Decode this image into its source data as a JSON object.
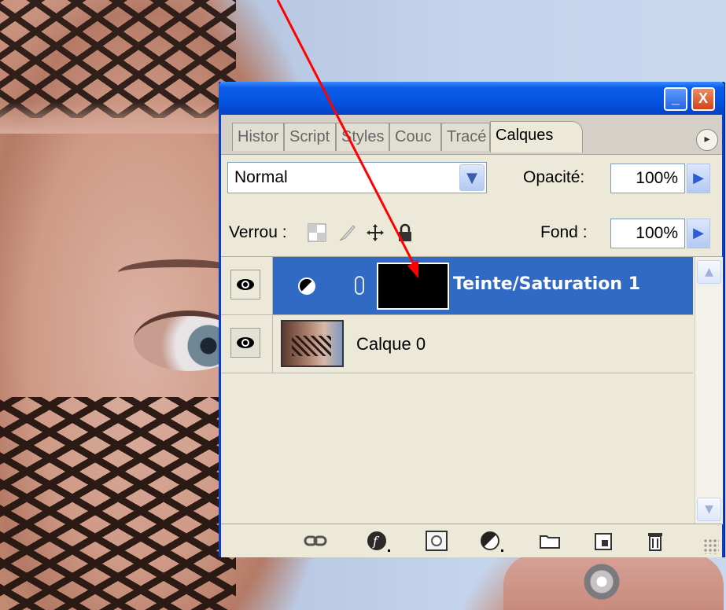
{
  "window": {
    "minimize_glyph": "_",
    "close_glyph": "X"
  },
  "tabs": [
    {
      "label": "Histor",
      "active": false
    },
    {
      "label": "Script",
      "active": false
    },
    {
      "label": "Styles",
      "active": false
    },
    {
      "label": "Couc",
      "active": false
    },
    {
      "label": "Tracé",
      "active": false
    },
    {
      "label": "Calques",
      "active": true
    }
  ],
  "blend": {
    "mode": "Normal",
    "opacity_label": "Opacité:",
    "opacity_value": "100%"
  },
  "lock": {
    "label": "Verrou :",
    "fill_label": "Fond :",
    "fill_value": "100%"
  },
  "layers": [
    {
      "name": "Teinte/Saturation 1",
      "visible": true,
      "selected": true,
      "type": "adjustment"
    },
    {
      "name": "Calque 0",
      "visible": true,
      "selected": false,
      "type": "image"
    }
  ],
  "toolbar_icons": [
    "link-icon",
    "layer-style-icon",
    "mask-icon",
    "adjustment-layer-icon",
    "group-folder-icon",
    "new-layer-icon",
    "trash-icon"
  ],
  "colors": {
    "selection": "#316ac5",
    "titlebar": "#0654e2",
    "arrow": "#ff0000"
  }
}
